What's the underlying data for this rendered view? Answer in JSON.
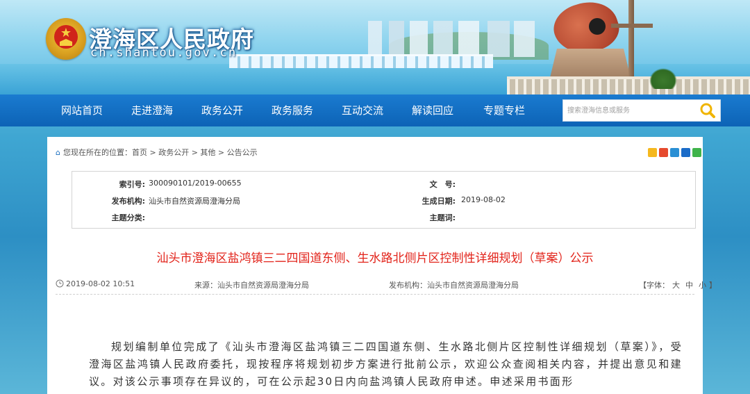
{
  "site": {
    "title": "澄海区人民政府",
    "domain": "ch.shantou.gov.cn"
  },
  "nav": {
    "items": [
      "网站首页",
      "走进澄海",
      "政务公开",
      "政务服务",
      "互动交流",
      "解读回应",
      "专题专栏"
    ],
    "search_placeholder": "搜索澄海信息或服务"
  },
  "breadcrumb": {
    "prefix": "您现在所在的位置：",
    "items": [
      "首页",
      "政务公开",
      "其他",
      "公告公示"
    ],
    "separator": " > "
  },
  "share_icons": [
    "qzone-icon",
    "weibo-icon",
    "tencent-weibo-icon",
    "renren-icon",
    "wechat-icon"
  ],
  "meta": {
    "index_label": "索引号:",
    "index_value": "300090101/2019-00655",
    "doc_no_label": "文　号:",
    "doc_no_value": "",
    "publisher_label": "发布机构:",
    "publisher_value": "汕头市自然资源局澄海分局",
    "date_label": "生成日期:",
    "date_value": "2019-08-02",
    "category_label": "主题分类:",
    "category_value": "",
    "keywords_label": "主题词:",
    "keywords_value": ""
  },
  "article": {
    "title": "汕头市澄海区盐鸿镇三二四国道东侧、生水路北侧片区控制性详细规划（草案）公示",
    "datetime": "2019-08-02 10:51",
    "source_label": "来源：",
    "source_value": "汕头市自然资源局澄海分局",
    "publisher_label": "发布机构：",
    "publisher_value": "汕头市自然资源局澄海分局",
    "font_size_open": "【字体：",
    "font_size_options": [
      "大",
      "中",
      "小"
    ],
    "font_size_close": "】",
    "body": "规划编制单位完成了《汕头市澄海区盐鸿镇三二四国道东侧、生水路北侧片区控制性详细规划（草案）》，受澄海区盐鸿镇人民政府委托，现按程序将规划初步方案进行批前公示，欢迎公众查阅相关内容，并提出意见和建议。对该公示事项存在异议的，可在公示起30日内向盐鸿镇人民政府申述。申述采用书面形"
  },
  "colors": {
    "nav_bg": "#0d63b6",
    "title_red": "#e2231a",
    "search_icon": "#f0b400"
  }
}
